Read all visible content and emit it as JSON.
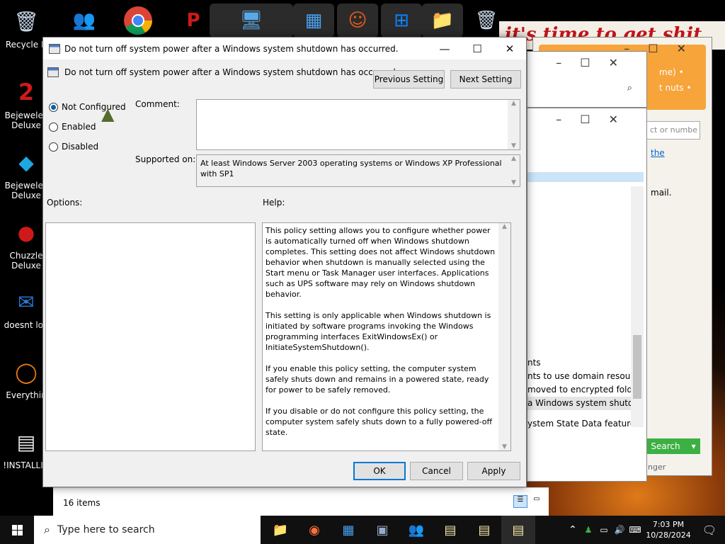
{
  "desktop": {
    "banner_text": "it's time to get shit",
    "left_icons": [
      {
        "name": "recycle-bin",
        "label": "Recycle B",
        "glyph": "🗑",
        "color": "#c8d8e8"
      },
      {
        "name": "bejeweled-1",
        "label": "Bejewelec\nDeluxe",
        "glyph": "2",
        "color": "#1a3ba8"
      },
      {
        "name": "bejeweled-2",
        "label": "Bejewelec\nDeluxe",
        "glyph": "◆",
        "color": "#1fa8e0"
      },
      {
        "name": "chuzzle",
        "label": "Chuzzle\nDeluxe",
        "glyph": "●",
        "color": "#d01a1a"
      },
      {
        "name": "thunderbird",
        "label": "doesnt loa",
        "glyph": "✉",
        "color": "#2a7bd8"
      },
      {
        "name": "everything",
        "label": "Everythin",
        "glyph": "◯",
        "color": "#f07a0a"
      },
      {
        "name": "installing-doc",
        "label": "!INSTALLIN",
        "glyph": "▤",
        "color": "#e8e8e8"
      }
    ]
  },
  "dialog": {
    "title": "Do not turn off system power after a Windows system shutdown has occurred.",
    "header_title": "Do not turn off system power after a Windows system shutdown has occurred.",
    "previous_setting": "Previous Setting",
    "next_setting": "Next Setting",
    "radio_not_configured": "Not Configured",
    "radio_enabled": "Enabled",
    "radio_disabled": "Disabled",
    "comment_label": "Comment:",
    "supported_label": "Supported on:",
    "supported_value": "At least Windows Server 2003 operating systems or Windows XP Professional with SP1",
    "options_label": "Options:",
    "help_label": "Help:",
    "help_p1": "This policy setting allows you to configure whether power is automatically turned off when Windows shutdown completes. This setting does not affect Windows shutdown behavior when shutdown is manually selected using the Start menu or Task Manager user interfaces.  Applications such as UPS software may rely on Windows shutdown behavior.",
    "help_p2": "This setting is only applicable when Windows shutdown is initiated by software programs invoking the Windows programming interfaces ExitWindowsEx() or InitiateSystemShutdown().",
    "help_p3": "If you enable this policy setting, the computer system safely shuts down and remains in a powered state, ready for power to be safely removed.",
    "help_p4": "If you disable or do not configure this policy setting, the computer system safely shuts down to a fully powered-off state.",
    "ok": "OK",
    "cancel": "Cancel",
    "apply": "Apply"
  },
  "behind_windows": {
    "orange_line1": "me) •",
    "orange_line2": "t nuts •",
    "search_placeholder": "ct or numbe",
    "link_text": "the",
    "mail_text": "mail.",
    "list_items": [
      "nts",
      "nts to use domain resour...",
      "moved to encrypted fold...",
      "a Windows system shutd...",
      "ystem State Data feature"
    ],
    "search_button": "Search",
    "bottom_text": "nger",
    "status_items": "16 items"
  },
  "taskbar": {
    "search_placeholder": "Type here to search",
    "time": "7:03 PM",
    "date": "10/28/2024"
  }
}
